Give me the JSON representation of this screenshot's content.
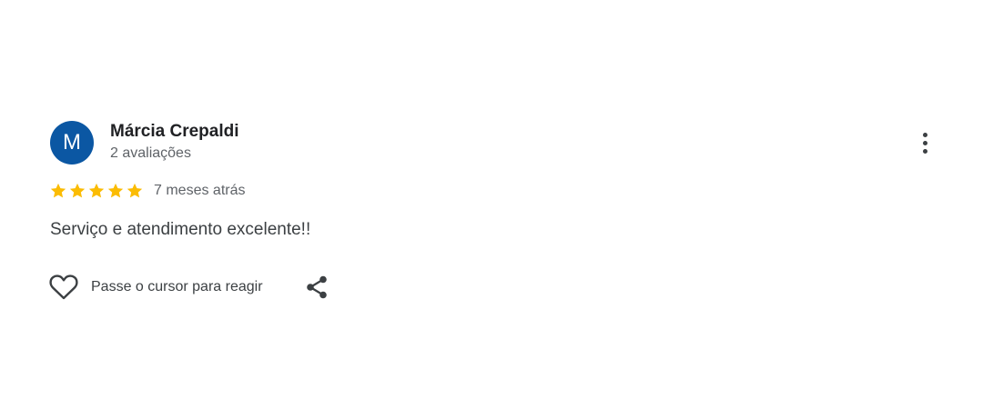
{
  "review": {
    "avatar": {
      "initial": "M",
      "color": "#0b57a3"
    },
    "author": {
      "name": "Márcia Crepaldi",
      "review_count_text": "2 avaliações"
    },
    "rating": {
      "stars": 5,
      "max_stars": 5,
      "star_color": "#fbbc04",
      "time_ago": "7 meses atrás"
    },
    "text": "Serviço e atendimento excelente!!",
    "actions": {
      "react_icon": "heart-outline-icon",
      "react_label": "Passe o cursor para reagir",
      "share_icon": "share-icon",
      "more_icon": "more-vertical-icon"
    }
  }
}
